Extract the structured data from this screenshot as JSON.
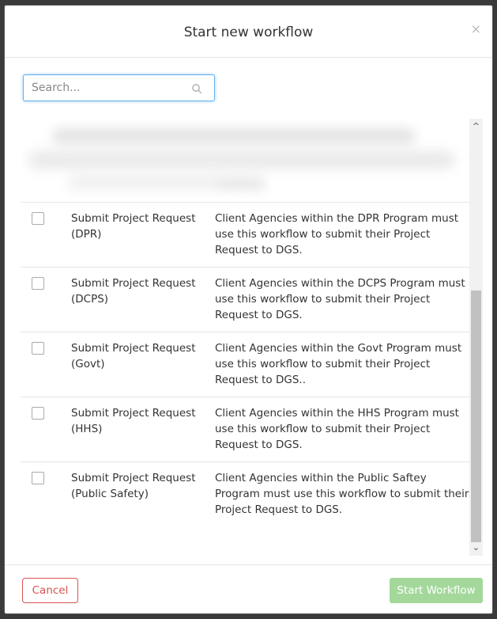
{
  "modal": {
    "title": "Start new workflow",
    "close_label": "×"
  },
  "search": {
    "placeholder": "Search...",
    "value": ""
  },
  "workflows": [
    {
      "name": "Submit Project Request (DPR)",
      "description": "Client Agencies within the DPR Program must use this workflow to submit their Project Request to DGS."
    },
    {
      "name": "Submit Project Request (DCPS)",
      "description": "Client Agencies within the DCPS Program must use this workflow to submit their Project Request to DGS."
    },
    {
      "name": "Submit Project Request (Govt)",
      "description": "Client Agencies within the Govt Program must use this workflow to submit their Project Request to DGS.."
    },
    {
      "name": "Submit Project Request (HHS)",
      "description": "Client Agencies within the HHS Program must use this workflow to submit their Project Request to DGS."
    },
    {
      "name": "Submit Project Request (Public Safety)",
      "description": "Client Agencies within the Public Saftey Program must use this workflow to submit their Project Request to DGS."
    }
  ],
  "footer": {
    "cancel_label": "Cancel",
    "start_label": "Start Workflow"
  },
  "icons": {
    "search": "search-icon",
    "close": "close-icon",
    "scroll_up": "chevron-up-icon",
    "scroll_down": "chevron-down-icon"
  },
  "colors": {
    "cancel": "#d9534f",
    "start_disabled": "#a3d89a",
    "focus_border": "#66afe9"
  }
}
